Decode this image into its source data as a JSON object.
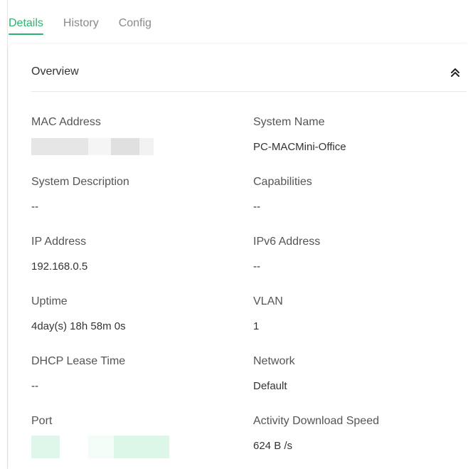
{
  "tabs": {
    "details": "Details",
    "history": "History",
    "config": "Config",
    "active": "Details"
  },
  "overview": {
    "title": "Overview",
    "collapse_icon": "chevron-double-up-icon"
  },
  "fields": {
    "mac_address": {
      "label": "MAC Address",
      "value": ""
    },
    "system_name": {
      "label": "System Name",
      "value": "PC-MACMini-Office"
    },
    "system_description": {
      "label": "System Description",
      "value": "--"
    },
    "capabilities": {
      "label": "Capabilities",
      "value": "--"
    },
    "ip_address": {
      "label": "IP Address",
      "value": "192.168.0.5"
    },
    "ipv6_address": {
      "label": "IPv6 Address",
      "value": "--"
    },
    "uptime": {
      "label": "Uptime",
      "value": "4day(s) 18h 58m 0s"
    },
    "vlan": {
      "label": "VLAN",
      "value": "1"
    },
    "dhcp_lease_time": {
      "label": "DHCP Lease Time",
      "value": "--"
    },
    "network": {
      "label": "Network",
      "value": "Default"
    },
    "port": {
      "label": "Port",
      "value": ""
    },
    "activity_download_speed": {
      "label": "Activity Download Speed",
      "value": "624 B /s"
    }
  },
  "colors": {
    "accent": "#2db36f",
    "redacted_gray": "#e5e5e5",
    "redacted_green": "#def7ea"
  }
}
